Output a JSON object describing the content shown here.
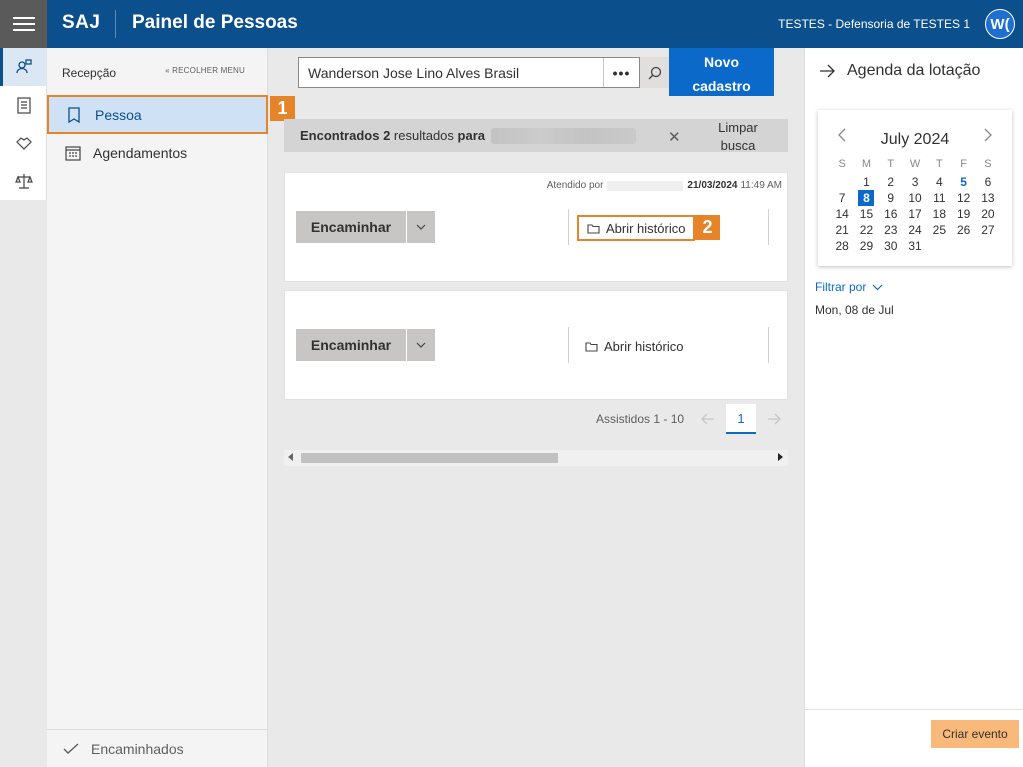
{
  "header": {
    "brand": "SAJ",
    "title": "Painel de Pessoas",
    "org": "TESTES - Defensoria de TESTES 1",
    "avatar_initials": "W(",
    "bar_color": "#0b4f8c"
  },
  "rail": {
    "items": [
      "people-icon",
      "clipboard-icon",
      "handshake-icon",
      "scales-icon"
    ]
  },
  "nav": {
    "section": "Recepção",
    "collapse_label": "« RECOLHER MENU",
    "items": [
      {
        "label": "Pessoa",
        "icon": "bookmark-icon",
        "active": true
      },
      {
        "label": "Agendamentos",
        "icon": "calendar-icon",
        "active": false
      }
    ],
    "footer": "Encaminhados",
    "badge1": "1"
  },
  "search": {
    "value": "Wanderson Jose Lino Alves Brasil",
    "more": "•••",
    "new_button": "Novo cadastro"
  },
  "results": {
    "prefix": "Encontrados 2",
    "middle": "resultados",
    "for": "para",
    "clear": "Limpar busca"
  },
  "cards": [
    {
      "attended_label": "Atendido por",
      "date": "21/03/2024",
      "time": "11:49 AM",
      "forward": "Encaminhar",
      "history": "Abrir histórico",
      "highlight_badge": "2"
    },
    {
      "forward": "Encaminhar",
      "history": "Abrir histórico"
    }
  ],
  "pager": {
    "label": "Assistidos 1 - 10",
    "page": "1"
  },
  "agenda": {
    "title": "Agenda da lotação",
    "month": "July 2024",
    "weekdays": [
      "S",
      "M",
      "T",
      "W",
      "T",
      "F",
      "S"
    ],
    "weeks": [
      [
        "",
        "1",
        "2",
        "3",
        "4",
        "5",
        "6"
      ],
      [
        "7",
        "8",
        "9",
        "10",
        "11",
        "12",
        "13"
      ],
      [
        "14",
        "15",
        "16",
        "17",
        "18",
        "19",
        "20"
      ],
      [
        "21",
        "22",
        "23",
        "24",
        "25",
        "26",
        "27"
      ],
      [
        "28",
        "29",
        "30",
        "31",
        "",
        "",
        ""
      ]
    ],
    "selected_day": "8",
    "today_day": "5",
    "filter": "Filtrar por",
    "filter_date": "Mon, 08 de Jul",
    "create_event": "Criar evento"
  }
}
